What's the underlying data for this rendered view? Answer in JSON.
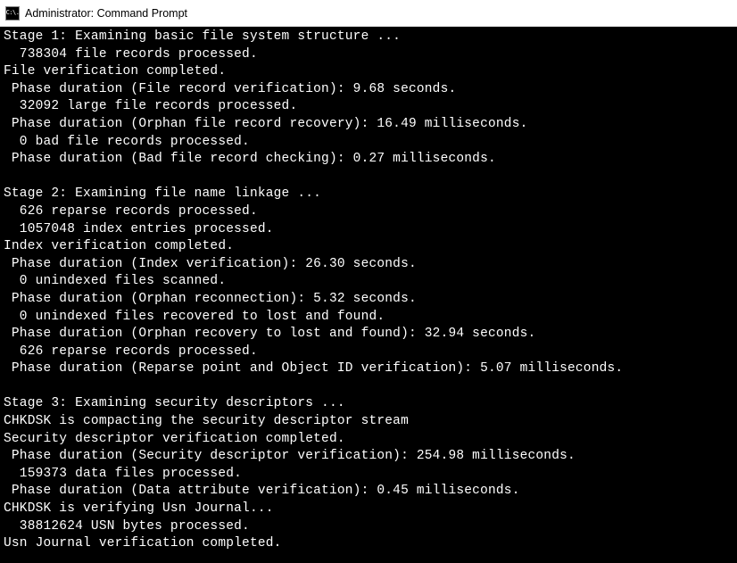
{
  "titlebar": {
    "icon_text": "C:\\.",
    "title": "Administrator: Command Prompt"
  },
  "lines": [
    "Stage 1: Examining basic file system structure ...",
    "  738304 file records processed.",
    "File verification completed.",
    " Phase duration (File record verification): 9.68 seconds.",
    "  32092 large file records processed.",
    " Phase duration (Orphan file record recovery): 16.49 milliseconds.",
    "  0 bad file records processed.",
    " Phase duration (Bad file record checking): 0.27 milliseconds.",
    "",
    "Stage 2: Examining file name linkage ...",
    "  626 reparse records processed.",
    "  1057048 index entries processed.",
    "Index verification completed.",
    " Phase duration (Index verification): 26.30 seconds.",
    "  0 unindexed files scanned.",
    " Phase duration (Orphan reconnection): 5.32 seconds.",
    "  0 unindexed files recovered to lost and found.",
    " Phase duration (Orphan recovery to lost and found): 32.94 seconds.",
    "  626 reparse records processed.",
    " Phase duration (Reparse point and Object ID verification): 5.07 milliseconds.",
    "",
    "Stage 3: Examining security descriptors ...",
    "CHKDSK is compacting the security descriptor stream",
    "Security descriptor verification completed.",
    " Phase duration (Security descriptor verification): 254.98 milliseconds.",
    "  159373 data files processed.",
    " Phase duration (Data attribute verification): 0.45 milliseconds.",
    "CHKDSK is verifying Usn Journal...",
    "  38812624 USN bytes processed.",
    "Usn Journal verification completed."
  ]
}
